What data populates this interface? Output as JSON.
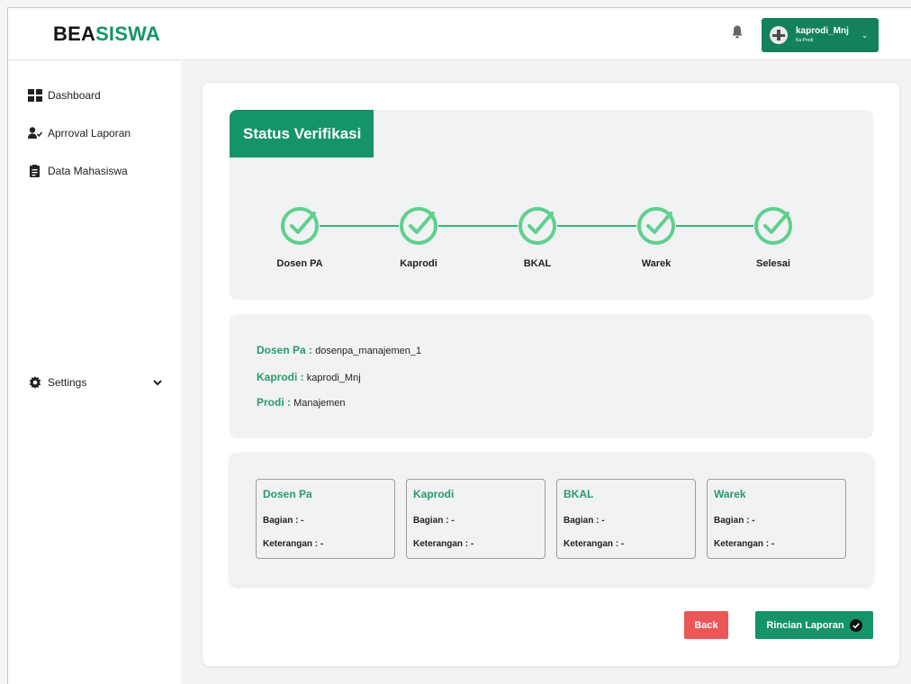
{
  "app": {
    "logo_part1": "BEA",
    "logo_part2": "SISWA",
    "accent": "#15946a"
  },
  "header": {
    "user_name": "kaprodi_Mnj",
    "user_role": "Ka Prodi",
    "bell_icon": "bell-icon",
    "chevron_icon": "chevron-down-icon"
  },
  "sidebar": {
    "items": [
      {
        "label": "Dashboard",
        "icon": "dashboard-grid-icon"
      },
      {
        "label": "Aprroval Laporan",
        "icon": "user-check-icon"
      },
      {
        "label": "Data Mahasiswa",
        "icon": "clipboard-icon"
      }
    ],
    "settings_label": "Settings"
  },
  "status": {
    "title": "Status Verifikasi",
    "steps": [
      "Dosen PA",
      "Kaprodi",
      "BKAL",
      "Warek",
      "Selesai"
    ],
    "step_color": "#5fd08e"
  },
  "info": {
    "dosen_pa_key": "Dosen Pa :",
    "dosen_pa_value": "dosenpa_manajemen_1",
    "kaprodi_key": "Kaprodi :",
    "kaprodi_value": "kaprodi_Mnj",
    "prodi_key": "Prodi :",
    "prodi_value": "Manajemen"
  },
  "responses": [
    {
      "title": "Dosen Pa",
      "bagian": "Bagian : -",
      "keterangan": "Keterangan : -"
    },
    {
      "title": "Kaprodi",
      "bagian": "Bagian : -",
      "keterangan": "Keterangan : -"
    },
    {
      "title": "BKAL",
      "bagian": "Bagian : -",
      "keterangan": "Keterangan : -"
    },
    {
      "title": "Warek",
      "bagian": "Bagian : -",
      "keterangan": "Keterangan : -"
    }
  ],
  "actions": {
    "back_label": "Back",
    "detail_label": "Rincian Laporan",
    "back_color": "#eb5757"
  }
}
